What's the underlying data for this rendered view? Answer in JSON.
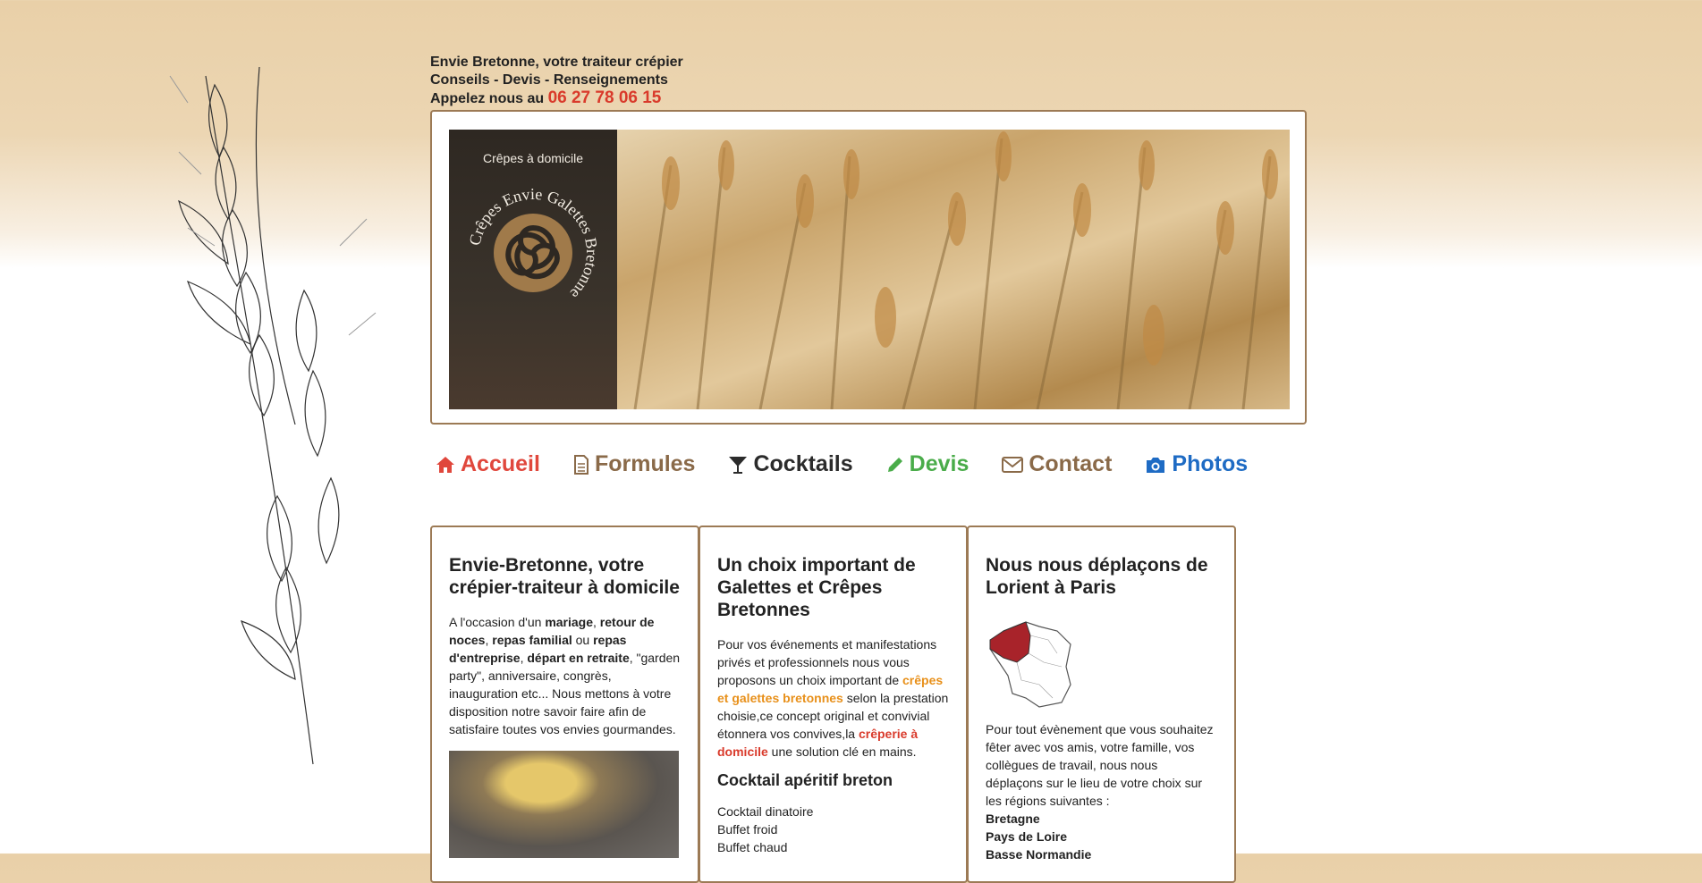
{
  "header": {
    "line1": "Envie Bretonne, votre traiteur crépier",
    "line2": "Conseils - Devis - Renseignements",
    "line3_prefix": "Appelez nous au",
    "phone": "06 27 78 06 15"
  },
  "banner": {
    "tagline": "Crêpes à domicile",
    "logo_text": "Crêpes Envie Galettes Bretonne"
  },
  "nav": [
    {
      "label": "Accueil",
      "icon": "home-icon"
    },
    {
      "label": "Formules",
      "icon": "document-icon"
    },
    {
      "label": "Cocktails",
      "icon": "cocktail-glass-icon"
    },
    {
      "label": "Devis",
      "icon": "pencil-icon"
    },
    {
      "label": "Contact",
      "icon": "envelope-icon"
    },
    {
      "label": "Photos",
      "icon": "camera-icon"
    }
  ],
  "col1": {
    "title": "Envie-Bretonne, votre crépier-traiteur à domicile",
    "t1": "A l'occasion d'un ",
    "b1": "mariage",
    "t2": ", ",
    "b2": "retour de noces",
    "t3": ", ",
    "b3": "repas familial",
    "t4": " ou ",
    "b4": "repas d'entreprise",
    "t5": ", ",
    "b5": "départ en retraite",
    "t6": ", \"garden party\", anniversaire, congrès, inauguration etc... Nous mettons à votre disposition notre savoir faire afin de satisfaire toutes vos envies gourmandes."
  },
  "col2": {
    "title": "Un choix important de Galettes et Crêpes Bretonnes",
    "t1": "Pour vos événements et manifestations privés et professionnels nous vous proposons un choix important de ",
    "hl1": "crêpes et galettes bretonnes",
    "t2": " selon la prestation choisie,ce concept original et convivial étonnera vos convives,la ",
    "hl2": "crêperie à domicile",
    "t3": " une solution clé en mains.",
    "subtitle": "Cocktail apéritif breton",
    "items": [
      "Cocktail dinatoire",
      "Buffet froid",
      "Buffet chaud"
    ]
  },
  "col3": {
    "title": "Nous nous déplaçons de Lorient à Paris",
    "text": "Pour tout évènement que vous souhaitez fêter avec vos amis, votre famille, vos collègues de travail, nous nous déplaçons sur le lieu de votre choix sur les régions suivantes :",
    "region1": "Bretagne",
    "region2": "Pays de Loire",
    "region3": "Basse Normandie"
  },
  "colors": {
    "phone": "#d93a2b",
    "frame": "#9c7a55",
    "accueil": "#e0473c",
    "formules": "#8a6a49",
    "cocktails": "#2b2b2b",
    "devis": "#4aac4a",
    "contact": "#8a6a49",
    "photos": "#1e6bc4"
  }
}
